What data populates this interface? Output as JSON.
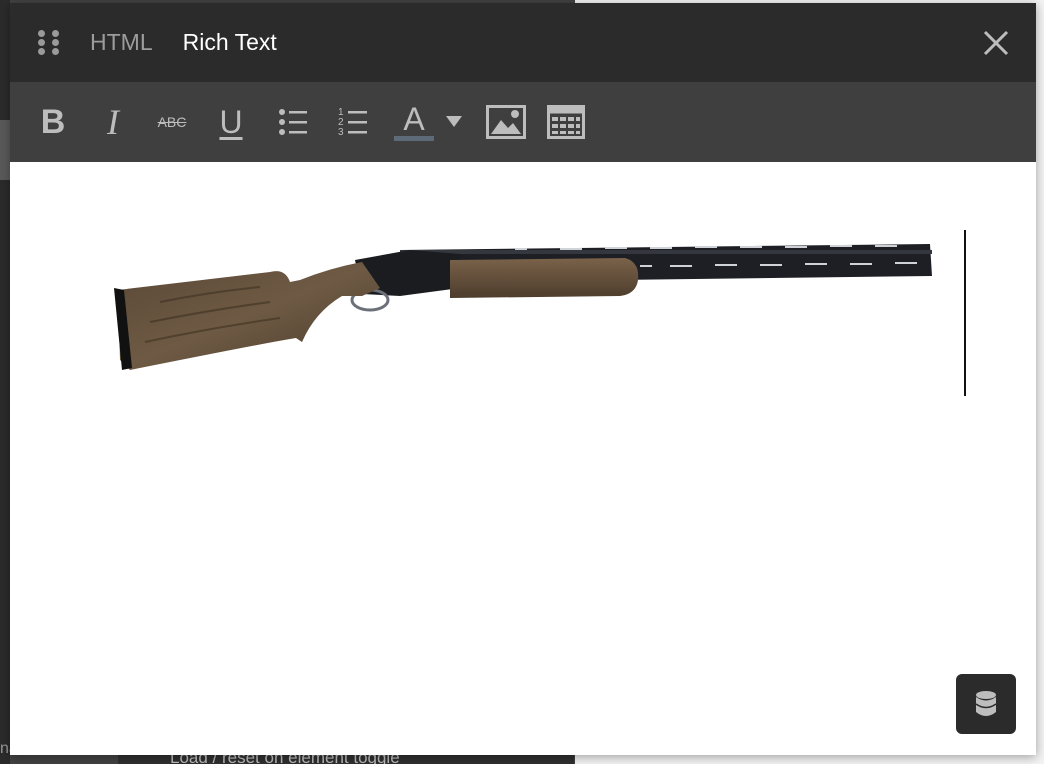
{
  "modal": {
    "tabs": [
      {
        "label": "HTML",
        "active": false
      },
      {
        "label": "Rich Text",
        "active": true
      }
    ],
    "close_icon": "close-icon",
    "drag_icon": "drag-handle-icon"
  },
  "toolbar": {
    "bold_label": "B",
    "italic_label": "I",
    "strikethrough_label": "ABC",
    "underline_label": "U",
    "text_color_label": "A",
    "text_color_value": "#5c6b77",
    "ordered_list_numbers": [
      "1",
      "2",
      "3"
    ],
    "icons": [
      "bold-icon",
      "italic-icon",
      "strikethrough-icon",
      "underline-icon",
      "bullet-list-icon",
      "numbered-list-icon",
      "text-color-icon",
      "chevron-down-icon",
      "image-icon",
      "table-icon"
    ]
  },
  "content": {
    "image_subject": "over-under shotgun",
    "data_button_icon": "database-icon"
  },
  "background": {
    "bottom_text": "Load / reset on element toggle",
    "bottom_left_text": "name"
  },
  "colors": {
    "header_bg": "#2b2b2b",
    "toolbar_bg": "#3f3f3f",
    "tab_active": "#ffffff",
    "tab_inactive": "#9c9c9c",
    "accent_green": "#3aa27a"
  }
}
